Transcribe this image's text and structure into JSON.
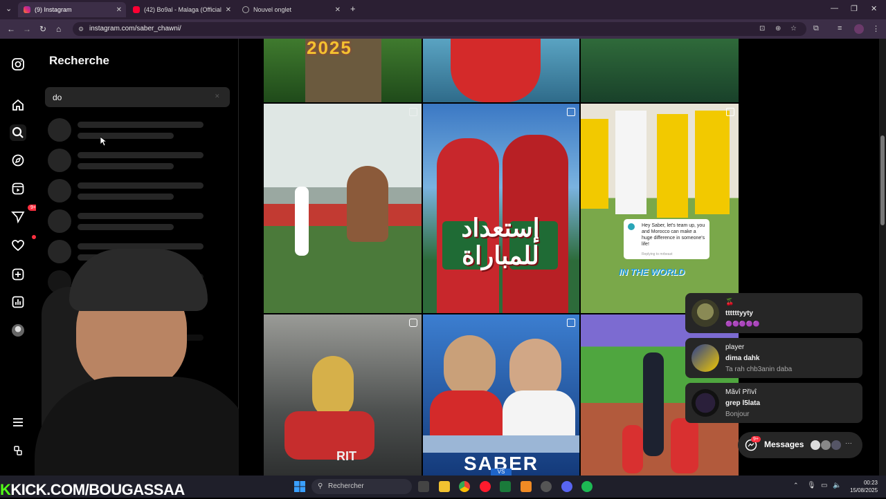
{
  "browser": {
    "tabs": [
      {
        "label": "(9) Instagram",
        "active": true
      },
      {
        "label": "(42) Bo9al - Malaga (Official M...",
        "active": false
      },
      {
        "label": "Nouvel onglet",
        "active": false
      }
    ],
    "new_tab_symbol": "+",
    "url": "instagram.com/saber_chawni/"
  },
  "sidebar": {
    "messages_badge": "9+",
    "icons": [
      "instagram-logo-icon",
      "home-icon",
      "search-icon",
      "explore-icon",
      "reels-icon",
      "messages-icon",
      "notifications-icon",
      "create-icon",
      "dashboard-icon",
      "profile-avatar",
      "menu-icon",
      "meta-icon"
    ]
  },
  "search": {
    "title": "Recherche",
    "query": "do"
  },
  "posts": {
    "tile_top_left_text": "2025",
    "tile_arabic_text": "إستعداد للمباراة",
    "tile_world_text": "IN THE WORLD",
    "mrbeast_message": "Hey Saber, let's team up, you and Morocco can make a huge difference in someone's life!",
    "mrbeast_reply": "Replying to mrbeast",
    "tile_rit_text": "RIT",
    "tile_saber_text": "SABER",
    "tile_vs_text": "VS"
  },
  "notifications": [
    {
      "line1": "🍒",
      "line2": "ttttttyyty",
      "line3": "🟣🟣🟣🟣🟣"
    },
    {
      "line1": "player",
      "line2": "dima dahk",
      "line3": "Ta rah chb3anin daba"
    },
    {
      "line1": "Mãvî Přïvî",
      "line2": "grep l5lata",
      "line3": "Bonjour"
    }
  ],
  "messages": {
    "label": "Messages",
    "badge": "9+",
    "more": "···"
  },
  "taskbar": {
    "search_label": "Rechercher",
    "time": "00:23",
    "date": "15/08/2025"
  },
  "overlay": {
    "kick_k": "K",
    "kick_text": "KICK.COM/BOUGASSAA"
  },
  "colors": {
    "instagram_bg": "#000000",
    "panel": "#262626",
    "badge": "#ff3040",
    "kick_green": "#53fc18"
  }
}
